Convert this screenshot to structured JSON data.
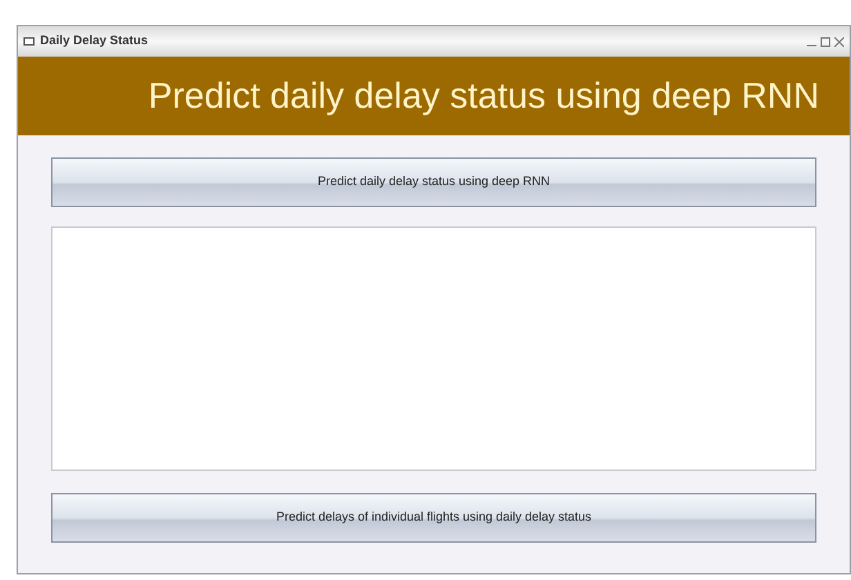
{
  "window": {
    "title": "Daily Delay Status"
  },
  "header": {
    "title": "Predict daily delay status using deep RNN"
  },
  "buttons": [
    {
      "label": "Predict daily delay status using deep RNN"
    },
    {
      "label": "Predict delays of individual flights using daily delay status"
    }
  ]
}
